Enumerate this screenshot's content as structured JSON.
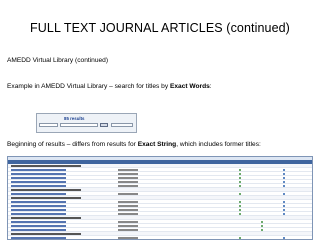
{
  "slide": {
    "title": "FULL TEXT JOURNAL ARTICLES (continued)",
    "subtitle": "AMEDD Virtual Library (continued)",
    "example_prefix": "Example in AMEDD Virtual Library – search for titles by ",
    "example_bold": "Exact Words",
    "example_suffix": ":",
    "beginning_prefix": "Beginning of results – differs from results for ",
    "beginning_bold": "Exact String",
    "beginning_suffix": ", which includes former titles:"
  },
  "search_panel": {
    "results_label": "85 results"
  },
  "results_table": {
    "rows": [
      {
        "type": "group"
      },
      {
        "type": "row",
        "dots": 2
      },
      {
        "type": "row",
        "dots": 2
      },
      {
        "type": "row",
        "dots": 2
      },
      {
        "type": "row",
        "dots": 2
      },
      {
        "type": "row",
        "dots": 2
      },
      {
        "type": "group"
      },
      {
        "type": "row",
        "dots": 2
      },
      {
        "type": "group"
      },
      {
        "type": "row",
        "dots": 2
      },
      {
        "type": "row",
        "dots": 2
      },
      {
        "type": "row",
        "dots": 2
      },
      {
        "type": "row",
        "dots": 2
      },
      {
        "type": "group"
      },
      {
        "type": "row",
        "dots": 1
      },
      {
        "type": "row",
        "dots": 1
      },
      {
        "type": "row",
        "dots": 1
      },
      {
        "type": "group"
      },
      {
        "type": "row",
        "dots": 2
      },
      {
        "type": "row",
        "dots": 2
      }
    ]
  }
}
